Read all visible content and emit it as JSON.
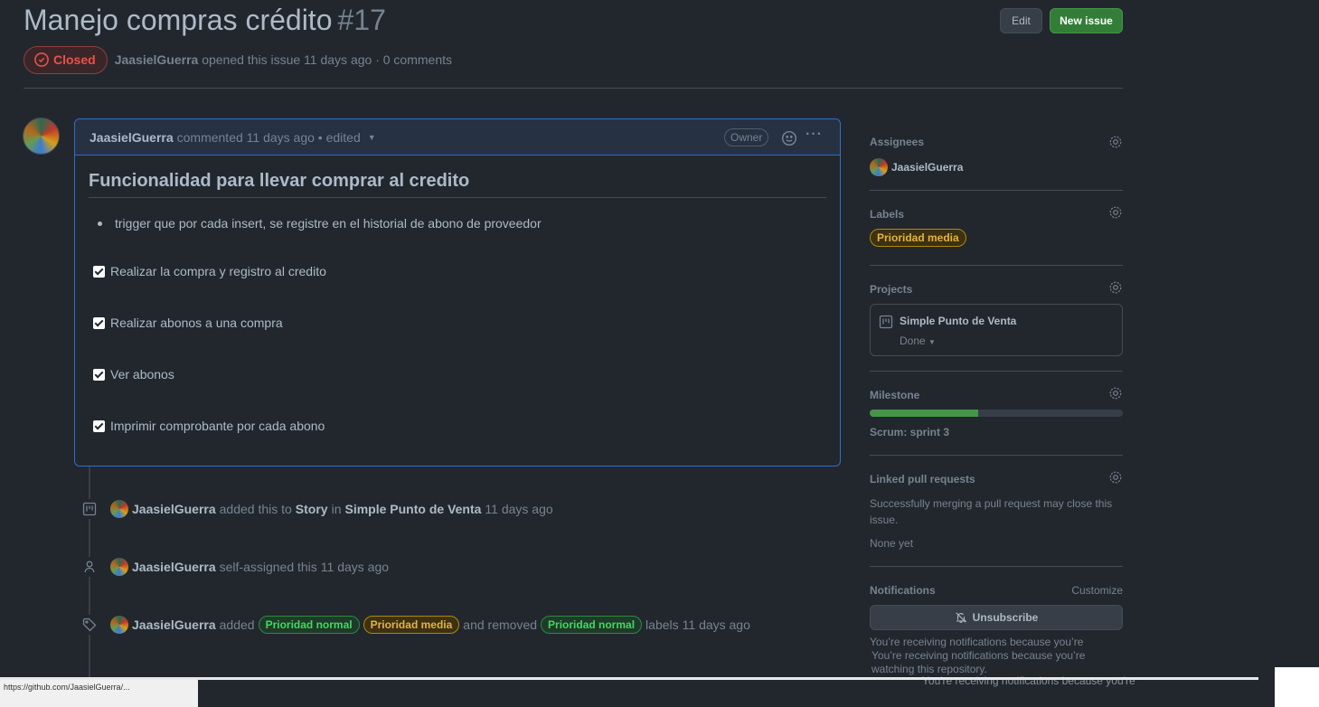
{
  "header": {
    "title": "Manejo compras crédito",
    "number": "#17",
    "edit_label": "Edit",
    "new_issue_label": "New issue",
    "state_label": "Closed",
    "author": "JaasielGuerra",
    "meta": "opened this issue 11 days ago · 0 comments"
  },
  "comment": {
    "author": "JaasielGuerra",
    "meta": "commented 11 days ago • edited",
    "owner_label": "Owner",
    "heading": "Funcionalidad para llevar comprar al credito",
    "bullets": [
      "trigger que por cada insert, se registre en el historial de abono de proveedor"
    ],
    "tasks": [
      {
        "label": "Realizar la compra y registro al credito",
        "checked": true
      },
      {
        "label": "Realizar abonos a una compra",
        "checked": true
      },
      {
        "label": "Ver abonos",
        "checked": true
      },
      {
        "label": "Imprimir comprobante por cada abono",
        "checked": true
      }
    ]
  },
  "timeline": {
    "e1": {
      "user": "JaasielGuerra",
      "t1": "added this to",
      "col": "Story",
      "t2": "in",
      "project": "Simple Punto de Venta",
      "time": "11 days ago"
    },
    "e2": {
      "user": "JaasielGuerra",
      "t1": "self-assigned this",
      "time": "11 days ago"
    },
    "e3": {
      "user": "JaasielGuerra",
      "t1": "added",
      "add1": "Prioridad normal",
      "add2": "Prioridad media",
      "t2": "and removed",
      "rem1": "Prioridad normal",
      "t3": "labels",
      "time": "11 days ago"
    }
  },
  "sidebar": {
    "assignees_title": "Assignees",
    "assignee": "JaasielGuerra",
    "labels_title": "Labels",
    "label": "Prioridad media",
    "projects_title": "Projects",
    "project_name": "Simple Punto de Venta",
    "project_status": "Done",
    "milestone_title": "Milestone",
    "milestone_progress_percent": 43,
    "milestone_name": "Scrum: sprint 3",
    "linked_title": "Linked pull requests",
    "linked_desc": "Successfully merging a pull request may close this issue.",
    "linked_none": "None yet",
    "notifications_title": "Notifications",
    "customize_label": "Customize",
    "unsubscribe_label": "Unsubscribe",
    "notif_line1": "You’re receiving notifications because you’re",
    "notif_line2": "You’re receiving notifications because you’re",
    "notif_line3": "watching this repository."
  },
  "overlay": {
    "ghost_text": "You're receiving notifications because you're",
    "status_text": "https://github.com/JaasielGuerra/..."
  }
}
